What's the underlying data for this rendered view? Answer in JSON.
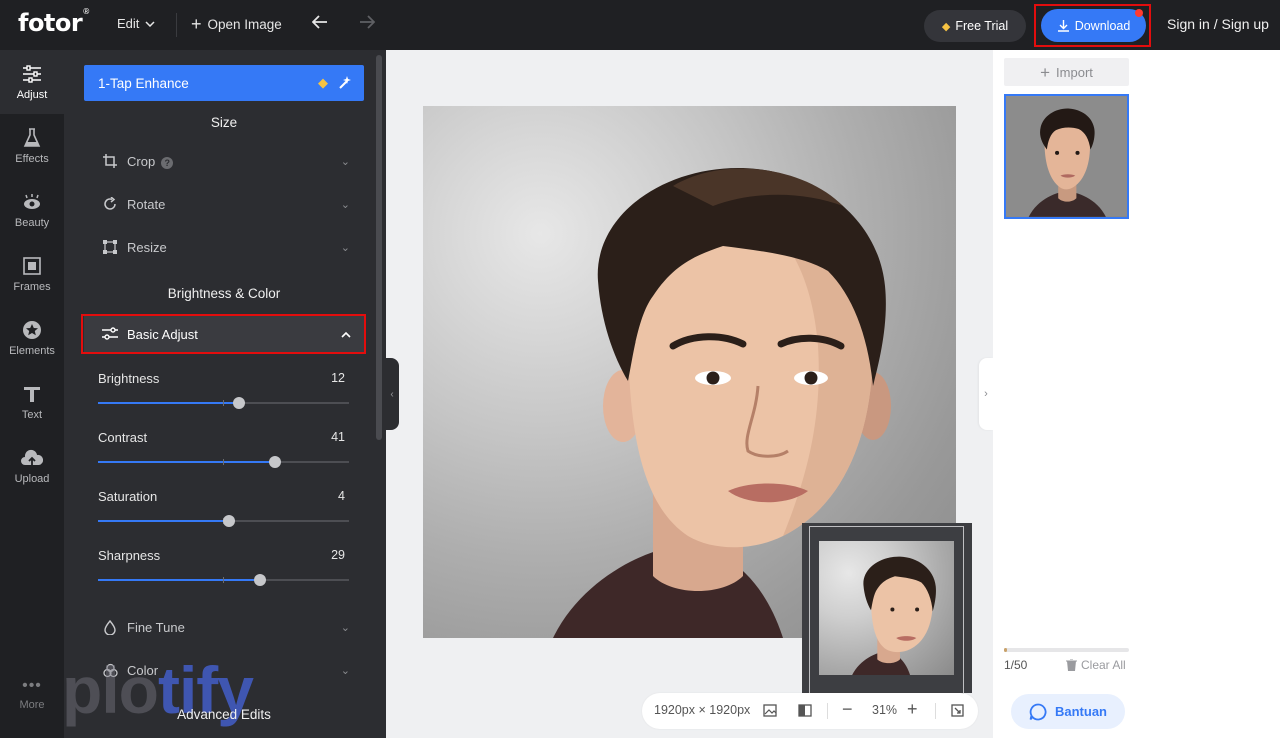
{
  "topbar": {
    "logo": "fotor",
    "logo_mark": "®",
    "edit_menu": "Edit",
    "open_image": "Open Image",
    "free_trial": "Free Trial",
    "download": "Download",
    "sign_in": "Sign in / Sign up",
    "download_highlight_color": "#e30d0d",
    "accent_color": "#3579f6"
  },
  "rail": {
    "items": [
      {
        "label": "Adjust",
        "icon": "sliders-icon",
        "active": true
      },
      {
        "label": "Effects",
        "icon": "flask-icon",
        "active": false
      },
      {
        "label": "Beauty",
        "icon": "eye-icon",
        "active": false
      },
      {
        "label": "Frames",
        "icon": "frame-icon",
        "active": false
      },
      {
        "label": "Elements",
        "icon": "star-circle-icon",
        "active": false
      },
      {
        "label": "Text",
        "icon": "text-t-icon",
        "active": false
      },
      {
        "label": "Upload",
        "icon": "cloud-upload-icon",
        "active": false
      }
    ],
    "more": "More"
  },
  "panel": {
    "enhance": "1-Tap Enhance",
    "size_title": "Size",
    "size_items": [
      {
        "label": "Crop",
        "icon": "crop-icon",
        "help": "?"
      },
      {
        "label": "Rotate",
        "icon": "rotate-icon"
      },
      {
        "label": "Resize",
        "icon": "resize-icon"
      }
    ],
    "color_title": "Brightness & Color",
    "basic_adjust": "Basic Adjust",
    "sliders": [
      {
        "label": "Brightness",
        "value": 12,
        "min": -100,
        "max": 100
      },
      {
        "label": "Contrast",
        "value": 41,
        "min": -100,
        "max": 100
      },
      {
        "label": "Saturation",
        "value": 4,
        "min": -100,
        "max": 100
      },
      {
        "label": "Sharpness",
        "value": 29,
        "min": -100,
        "max": 100
      }
    ],
    "more_items": [
      {
        "label": "Fine Tune",
        "icon": "droplet-icon"
      },
      {
        "label": "Color",
        "icon": "palette-icon"
      }
    ],
    "advanced_title": "Advanced Edits",
    "watermark": {
      "part1": "plo",
      "part2": "tify"
    }
  },
  "canvas": {
    "dimensions": "1920px × 1920px",
    "zoom": "31%"
  },
  "right_panel": {
    "import": "Import",
    "count": "1/50",
    "progress": 0.02,
    "clear_all": "Clear All",
    "help_button": "Bantuan"
  }
}
